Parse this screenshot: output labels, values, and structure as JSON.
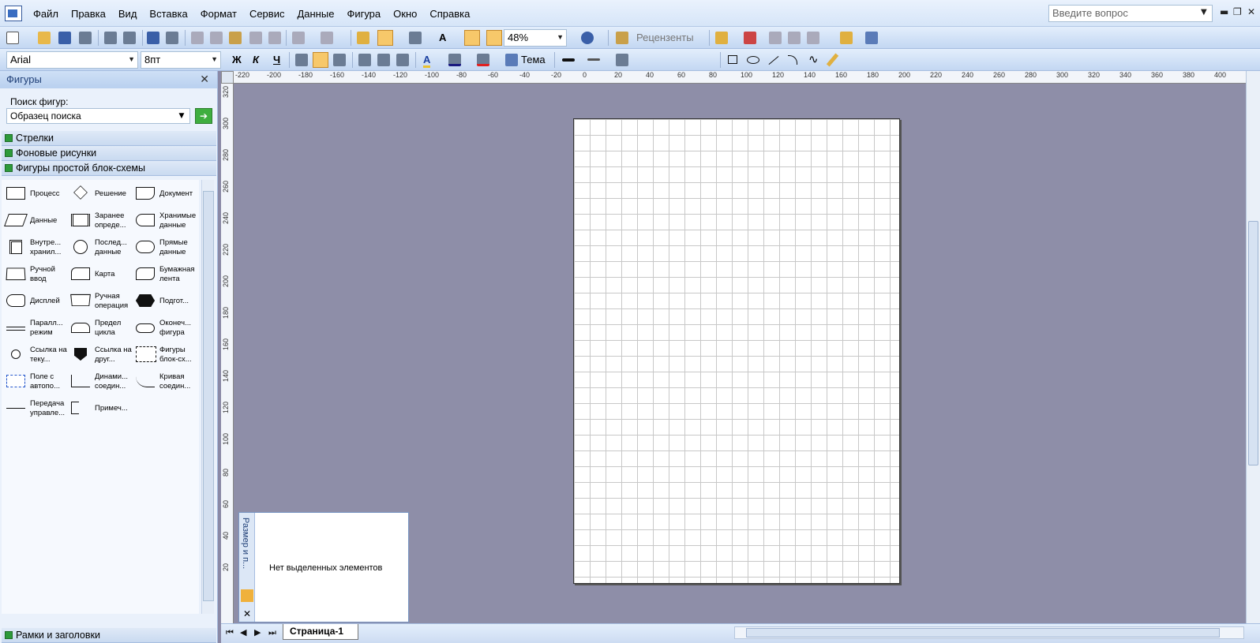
{
  "menubar": {
    "items": [
      "Файл",
      "Правка",
      "Вид",
      "Вставка",
      "Формат",
      "Сервис",
      "Данные",
      "Фигура",
      "Окно",
      "Справка"
    ],
    "question_placeholder": "Введите вопрос"
  },
  "toolbar1": {
    "zoom": "48%",
    "reviewers": "Рецензенты"
  },
  "toolbar2": {
    "font": "Arial",
    "font_size": "8пт",
    "bold": "Ж",
    "italic": "К",
    "underline": "Ч",
    "theme": "Тема"
  },
  "shapes_panel": {
    "title": "Фигуры",
    "search_label": "Поиск фигур:",
    "search_value": "Образец поиска",
    "stencils": [
      "Стрелки",
      "Фоновые рисунки",
      "Фигуры простой блок-схемы"
    ],
    "bottom_stencil": "Рамки и заголовки",
    "shapes": [
      "Процесс",
      "Решение",
      "Документ",
      "Данные",
      "Заранее опреде...",
      "Хранимые данные",
      "Внутре... хранил...",
      "Послед... данные",
      "Прямые данные",
      "Ручной ввод",
      "Карта",
      "Бумажная лента",
      "Дисплей",
      "Ручная операция",
      "Подгот...",
      "Паралл... режим",
      "Предел цикла",
      "Оконеч... фигура",
      "Ссылка на теку...",
      "Ссылка на друг...",
      "Фигуры блок-сх...",
      "Поле с автопо...",
      "Динами... соедин...",
      "Кривая соедин...",
      "Передача управле...",
      "Примеч..."
    ]
  },
  "ruler_h": [
    "-220",
    "-200",
    "-180",
    "-160",
    "-140",
    "-120",
    "-100",
    "-80",
    "-60",
    "-40",
    "-20",
    "0",
    "20",
    "40",
    "60",
    "80",
    "100",
    "120",
    "140",
    "160",
    "180",
    "200",
    "220",
    "240",
    "260",
    "280",
    "300",
    "320",
    "340",
    "360",
    "380",
    "400"
  ],
  "ruler_v": [
    "320",
    "300",
    "280",
    "260",
    "240",
    "220",
    "200",
    "180",
    "160",
    "140",
    "120",
    "100",
    "80",
    "60",
    "40",
    "20"
  ],
  "size_position": {
    "title": "Размер и п...",
    "message": "Нет выделенных элементов"
  },
  "page_tabs": {
    "current": "Страница-1"
  }
}
